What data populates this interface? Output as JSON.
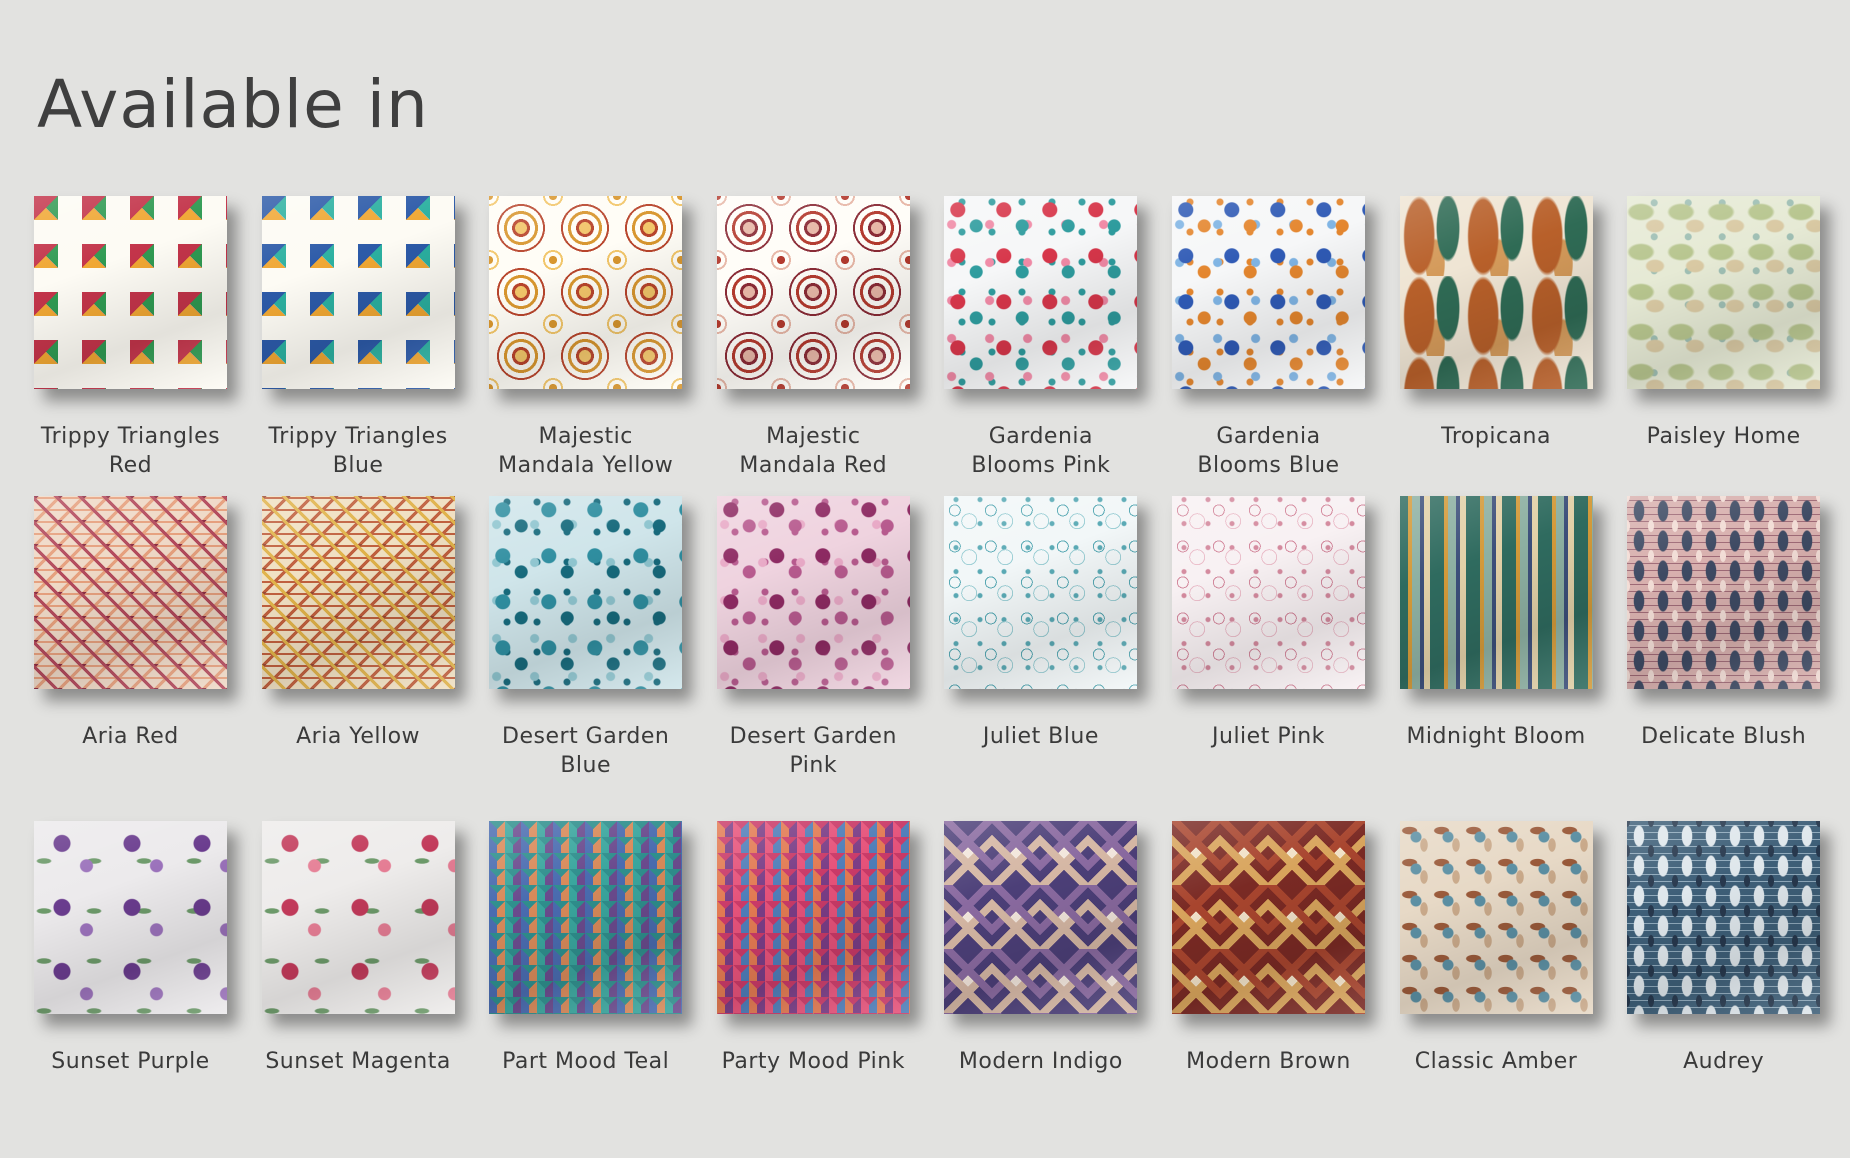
{
  "title": "Available in",
  "swatches": [
    {
      "name": "Trippy Triangles Red",
      "pattern": "triangles",
      "colors": [
        "#fdfbf4",
        "#c3344a",
        "#2f9a52",
        "#f0a733",
        "#e48a9a"
      ]
    },
    {
      "name": "Trippy Triangles Blue",
      "pattern": "triangles",
      "colors": [
        "#fdfbf4",
        "#2c5aa8",
        "#2bb0a0",
        "#f0a733",
        "#7fc6d8"
      ]
    },
    {
      "name": "Majestic Mandala Yellow",
      "pattern": "mandala",
      "colors": [
        "#fffdf6",
        "#d8962e",
        "#b8452c",
        "#f2c66a"
      ]
    },
    {
      "name": "Majestic Mandala Red",
      "pattern": "mandala",
      "colors": [
        "#fffdf8",
        "#b33a2e",
        "#8a2b36",
        "#e7b7a7"
      ]
    },
    {
      "name": "Gardenia Blooms Pink",
      "pattern": "floral",
      "colors": [
        "#f6f7f8",
        "#d7364a",
        "#2e9c9e",
        "#f08aa6"
      ]
    },
    {
      "name": "Gardenia Blooms Blue",
      "pattern": "floral",
      "colors": [
        "#f6f7f8",
        "#2f5ab5",
        "#e4862e",
        "#7fb4e4"
      ]
    },
    {
      "name": "Tropicana",
      "pattern": "leaves",
      "colors": [
        "#efe5d4",
        "#b8602a",
        "#2f6b55",
        "#d49a5a"
      ]
    },
    {
      "name": "Paisley Home",
      "pattern": "paisley",
      "colors": [
        "#e6ead5",
        "#b7c58e",
        "#d9c9a3",
        "#9fbfb4"
      ]
    },
    {
      "name": "Aria Red",
      "pattern": "diamond",
      "colors": [
        "#efd9c7",
        "#b34a5c",
        "#e6a07e",
        "#8c2f44"
      ]
    },
    {
      "name": "Aria Yellow",
      "pattern": "diamond",
      "colors": [
        "#f0e0c2",
        "#e0b24a",
        "#c0603e",
        "#9a4a36"
      ]
    },
    {
      "name": "Desert Garden Blue",
      "pattern": "floral",
      "colors": [
        "#cfe5ea",
        "#2f8ea0",
        "#176a7c",
        "#8fc5cf"
      ]
    },
    {
      "name": "Desert Garden Pink",
      "pattern": "floral",
      "colors": [
        "#efd3df",
        "#8d2a62",
        "#b75a8e",
        "#e8a9c6"
      ]
    },
    {
      "name": "Juliet Blue",
      "pattern": "toile",
      "colors": [
        "#f2f7f8",
        "#5aaab5",
        "#9fd0d6"
      ]
    },
    {
      "name": "Juliet Pink",
      "pattern": "toile",
      "colors": [
        "#f8f1f3",
        "#d48a9e",
        "#ebbfcb"
      ]
    },
    {
      "name": "Midnight Bloom",
      "pattern": "stripes",
      "colors": [
        "#2f6b5f",
        "#d39a3a",
        "#8db0a2",
        "#3c4f7a",
        "#e2d1a8"
      ]
    },
    {
      "name": "Delicate Blush",
      "pattern": "ikat",
      "colors": [
        "#d8b0ae",
        "#3e4a63",
        "#f2ddd6",
        "#9e6a76"
      ]
    },
    {
      "name": "Sunset Purple",
      "pattern": "sparsefloral",
      "colors": [
        "#eceaec",
        "#6a3c8e",
        "#9b72bb",
        "#6d9a6a"
      ]
    },
    {
      "name": "Sunset Magenta",
      "pattern": "sparsefloral",
      "colors": [
        "#eeeceb",
        "#c23a5a",
        "#e57d94",
        "#6d9a6a"
      ]
    },
    {
      "name": "Part Mood Teal",
      "pattern": "chevron",
      "colors": [
        "#2f8f8d",
        "#4a6cb0",
        "#d88a5a",
        "#3aa69e",
        "#6b4b8e"
      ]
    },
    {
      "name": "Party Mood Pink",
      "pattern": "chevron",
      "colors": [
        "#c93a68",
        "#e27a52",
        "#7a3d86",
        "#e6527a",
        "#4f7db8"
      ]
    },
    {
      "name": "Modern Indigo",
      "pattern": "kilim",
      "colors": [
        "#4c3f78",
        "#d5b7a4",
        "#8a6aa0",
        "#f2e6dc"
      ]
    },
    {
      "name": "Modern Brown",
      "pattern": "kilim",
      "colors": [
        "#7a2a24",
        "#d8a45c",
        "#a8452e",
        "#f1e2c8"
      ]
    },
    {
      "name": "Classic Amber",
      "pattern": "damask",
      "colors": [
        "#e7d9c6",
        "#9a5a3a",
        "#5b8fa3",
        "#c9a98a"
      ]
    },
    {
      "name": "Audrey",
      "pattern": "ikat",
      "colors": [
        "#3e5f78",
        "#dfe7ec",
        "#27384d",
        "#8fa9bb"
      ]
    }
  ]
}
